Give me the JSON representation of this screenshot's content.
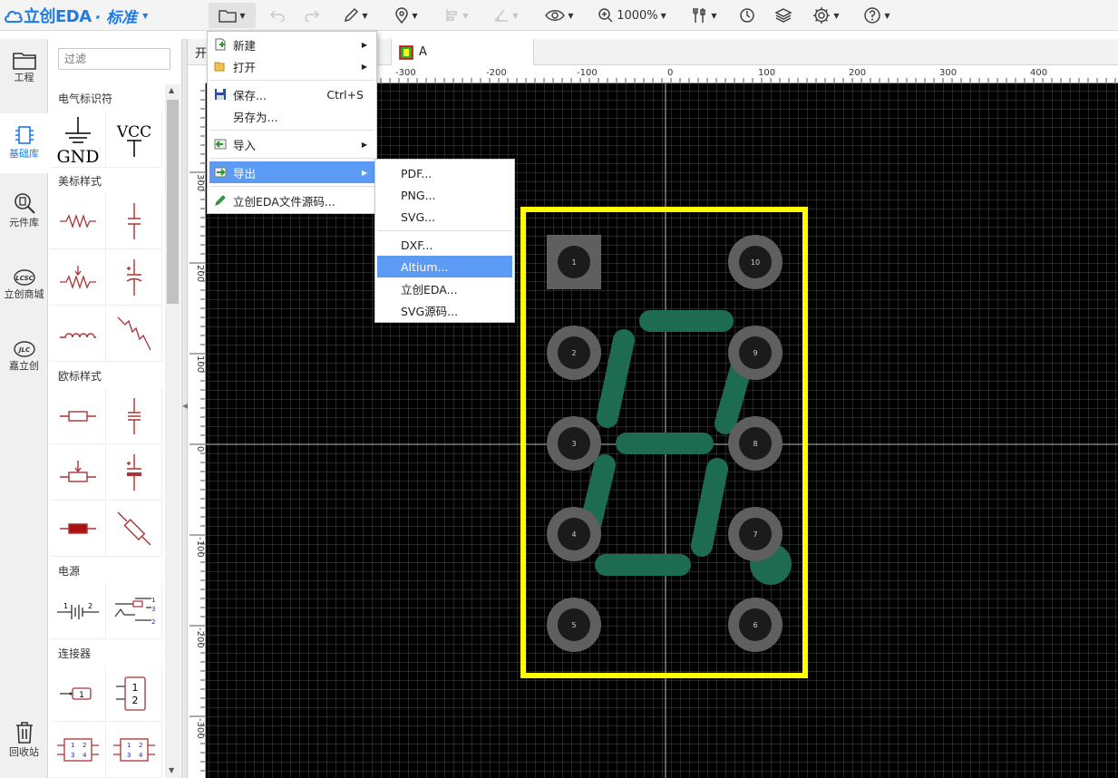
{
  "app": {
    "brand": "立创EDA",
    "edition": "· 标准",
    "brand_color": "#1e7be6"
  },
  "toolbar": {
    "zoom": "1000%"
  },
  "rail": {
    "items": [
      {
        "label": "工程"
      },
      {
        "label": "基础库"
      },
      {
        "label": "元件库"
      },
      {
        "label": "立创商城"
      },
      {
        "label": "嘉立创"
      },
      {
        "label": "回收站"
      }
    ]
  },
  "library": {
    "filter_placeholder": "过滤",
    "categories": [
      "电气标识符",
      "美标样式",
      "欧标样式",
      "电源",
      "连接器"
    ],
    "gnd_label": "GND",
    "vcc_label": "VCC"
  },
  "tabs": {
    "first_partial": "开",
    "active": "A"
  },
  "ruler": {
    "x_ticks": [
      "-300",
      "-200",
      "-100",
      "0",
      "100",
      "200",
      "300",
      "400"
    ],
    "y_ticks": [
      "300",
      "200",
      "100",
      "0",
      "-100",
      "-200",
      "-300"
    ]
  },
  "pcb": {
    "pads": [
      "1",
      "2",
      "3",
      "4",
      "5",
      "6",
      "7",
      "8",
      "9",
      "10"
    ],
    "outline_color": "#ffff00",
    "segment_color": "#1d6b50",
    "pad_color": "#5f5f5f"
  },
  "file_menu": {
    "new": "新建",
    "open": "打开",
    "save": "保存...",
    "save_shortcut": "Ctrl+S",
    "save_as": "另存为...",
    "import": "导入",
    "export": "导出",
    "source": "立创EDA文件源码..."
  },
  "export_menu": {
    "pdf": "PDF...",
    "png": "PNG...",
    "svg": "SVG...",
    "dxf": "DXF...",
    "altium": "Altium...",
    "lceda": "立创EDA...",
    "svg_source": "SVG源码..."
  }
}
